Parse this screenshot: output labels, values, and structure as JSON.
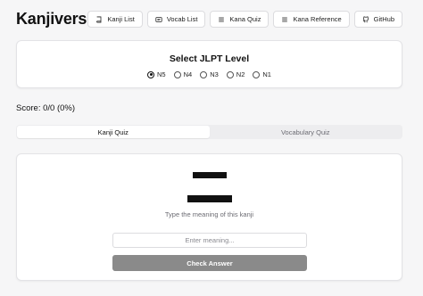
{
  "header": {
    "brand": "Kanjiverse",
    "nav": [
      {
        "label": "Kanji List",
        "icon": "book-icon"
      },
      {
        "label": "Vocab List",
        "icon": "vocab-card-icon"
      },
      {
        "label": "Kana Quiz",
        "icon": "list-icon"
      },
      {
        "label": "Kana Reference",
        "icon": "list-icon"
      },
      {
        "label": "GitHub",
        "icon": "github-icon"
      }
    ]
  },
  "level_selector": {
    "title": "Select JLPT Level",
    "options": [
      "N5",
      "N4",
      "N3",
      "N2",
      "N1"
    ],
    "selected": "N5"
  },
  "score": "Score: 0/0 (0%)",
  "tabs": [
    {
      "label": "Kanji Quiz",
      "active": true
    },
    {
      "label": "Vocabulary Quiz",
      "active": false
    }
  ],
  "quiz": {
    "kanji": "二",
    "prompt": "Type the meaning of this kanji",
    "input_placeholder": "Enter meaning...",
    "input_value": "",
    "submit_label": "Check Answer"
  },
  "colors": {
    "background": "#f6f6f7",
    "button_disabled": "#8a8a8a"
  }
}
